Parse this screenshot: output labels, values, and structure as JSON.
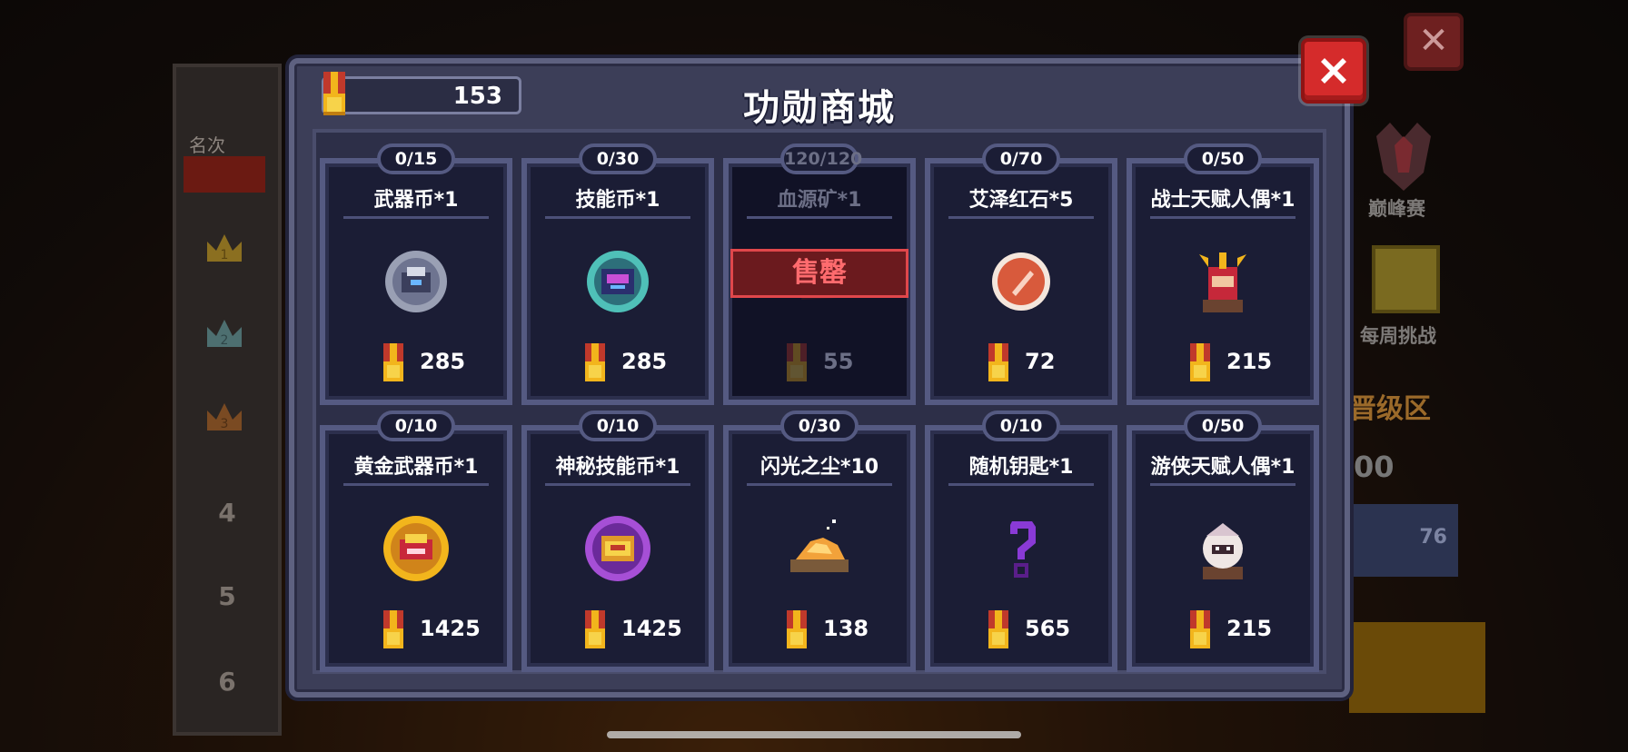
{
  "colors": {
    "accent_red": "#d52b2b",
    "card_bg": "#1b1d35",
    "card_border": "#555a82",
    "medal_gold": "#f2b51c",
    "medal_red": "#c0392b",
    "soldout_red": "#e0474b"
  },
  "background": {
    "rank_header": "名次",
    "ranks": [
      "4",
      "5",
      "6"
    ],
    "peak_label": "巅峰赛",
    "weekly_label": "每周挑战",
    "promo_zone": "晋级区",
    "partial_number": "00",
    "partial_slot": "76"
  },
  "shop": {
    "title": "功勋商城",
    "balance": "153",
    "balance_icon": "medal-icon",
    "close_icon": "close-icon",
    "items": [
      {
        "name": "武器币*1",
        "stock": "0/15",
        "price": "285",
        "icon": "weapon-coin-icon",
        "sold_out": false
      },
      {
        "name": "技能币*1",
        "stock": "0/30",
        "price": "285",
        "icon": "skill-coin-icon",
        "sold_out": false
      },
      {
        "name": "血源矿*1",
        "stock": "120/120",
        "price": "55",
        "icon": "blood-ore-icon",
        "sold_out": true,
        "sold_out_label": "售罄"
      },
      {
        "name": "艾泽红石*5",
        "stock": "0/70",
        "price": "72",
        "icon": "red-stone-icon",
        "sold_out": false
      },
      {
        "name": "战士天赋人偶*1",
        "stock": "0/50",
        "price": "215",
        "icon": "warrior-doll-icon",
        "sold_out": false
      },
      {
        "name": "黄金武器币*1",
        "stock": "0/10",
        "price": "1425",
        "icon": "gold-weapon-coin-icon",
        "sold_out": false
      },
      {
        "name": "神秘技能币*1",
        "stock": "0/10",
        "price": "1425",
        "icon": "mystery-skill-coin-icon",
        "sold_out": false
      },
      {
        "name": "闪光之尘*10",
        "stock": "0/30",
        "price": "138",
        "icon": "flash-dust-icon",
        "sold_out": false
      },
      {
        "name": "随机钥匙*1",
        "stock": "0/10",
        "price": "565",
        "icon": "random-key-icon",
        "sold_out": false
      },
      {
        "name": "游侠天赋人偶*1",
        "stock": "0/50",
        "price": "215",
        "icon": "ranger-doll-icon",
        "sold_out": false
      }
    ]
  }
}
